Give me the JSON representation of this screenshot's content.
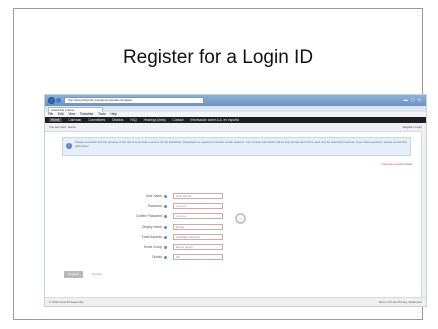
{
  "slide": {
    "title": "Register for a Login ID"
  },
  "browser": {
    "url": "http://assemblyhub.org/apps/registration/register",
    "tab_title": "Assembly | Home",
    "menus": [
      "File",
      "Edit",
      "View",
      "Favorites",
      "Tools",
      "Help"
    ]
  },
  "site": {
    "nav": [
      "Home",
      "Calendar",
      "Committees",
      "Districts",
      "FAQ",
      "Hearings (beta)",
      "Contact",
      "Información sobre A.A. en español"
    ],
    "breadcrumb": "You are here: Home",
    "top_links": "Register   Login",
    "notice": "Please remember that the purpose of this site is to provide a service for the fellowship. Registration is required to access certain features. Your contact information will be kept private and will be used only for assembly business. If you have questions, please contact the webmaster.",
    "required_note": "* Denotes required field",
    "fields": [
      {
        "label": "User Name",
        "value": "User Name"
      },
      {
        "label": "Password",
        "value": "••••••••••"
      },
      {
        "label": "Confirm Password",
        "value": "••••••••••"
      },
      {
        "label": "Display Name",
        "value": "Name"
      },
      {
        "label": "Email Address",
        "value": "email@email.com"
      },
      {
        "label": "Home Group",
        "value": "Home group"
      },
      {
        "label": "District",
        "value": "All"
      }
    ],
    "register_label": "Register",
    "cancel_label": "Cancel",
    "footer_left": "© 2012 Area 09 Assembly",
    "footer_right": "Terms Of Use   Privacy Statement"
  }
}
